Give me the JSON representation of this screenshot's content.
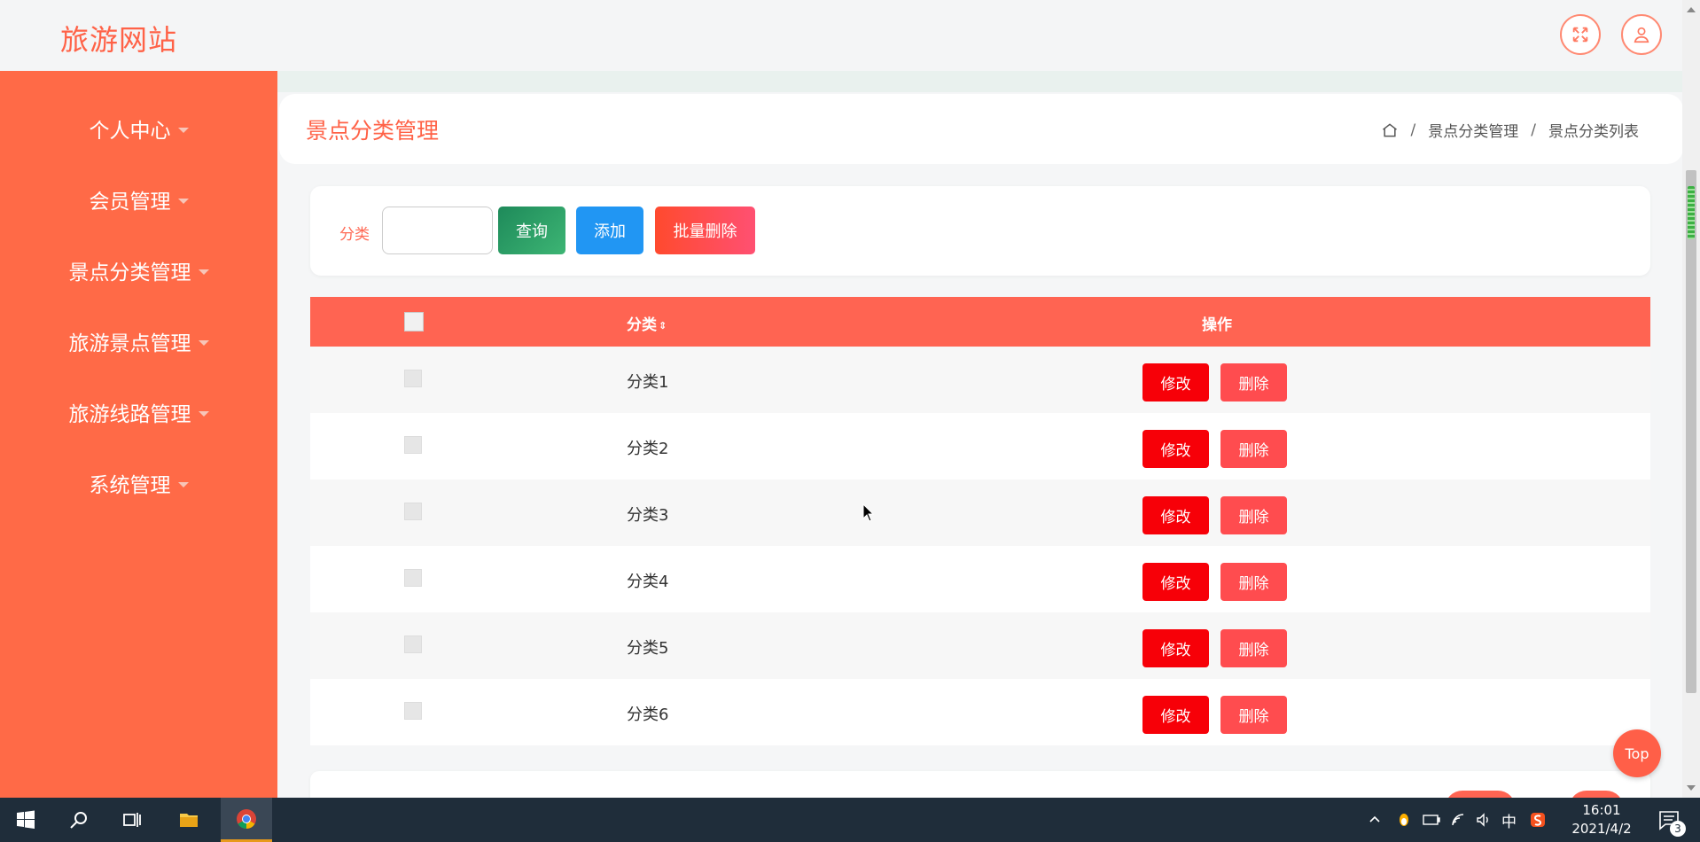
{
  "header": {
    "logo": "旅游网站",
    "fullscreen_icon": "fullscreen-icon",
    "user_icon": "user-icon"
  },
  "sidebar": {
    "items": [
      {
        "label": "个人中心"
      },
      {
        "label": "会员管理"
      },
      {
        "label": "景点分类管理"
      },
      {
        "label": "旅游景点管理"
      },
      {
        "label": "旅游线路管理"
      },
      {
        "label": "系统管理"
      }
    ]
  },
  "page": {
    "title": "景点分类管理",
    "breadcrumb": [
      "景点分类管理",
      "景点分类列表"
    ]
  },
  "search": {
    "label": "分类",
    "input_value": "",
    "query_label": "查询",
    "add_label": "添加",
    "batch_delete_label": "批量删除"
  },
  "table": {
    "columns": [
      "分类",
      "操作"
    ],
    "rows": [
      {
        "category": "分类1",
        "edit": "修改",
        "delete": "删除"
      },
      {
        "category": "分类2",
        "edit": "修改",
        "delete": "删除"
      },
      {
        "category": "分类3",
        "edit": "修改",
        "delete": "删除"
      },
      {
        "category": "分类4",
        "edit": "修改",
        "delete": "删除"
      },
      {
        "category": "分类5",
        "edit": "修改",
        "delete": "删除"
      },
      {
        "category": "分类6",
        "edit": "修改",
        "delete": "删除"
      }
    ]
  },
  "top_button": "Top",
  "taskbar": {
    "ime": "中",
    "time": "16:01",
    "date": "2021/4/2",
    "notifications": "3"
  },
  "colors": {
    "accent": "#ff6247",
    "sidebar": "#ff6a47",
    "table_header": "#ff6452",
    "edit_button": "#f70008",
    "delete_button": "#ff4c4f",
    "add_button": "#2196f3",
    "query_button": "#1e8a5a"
  }
}
